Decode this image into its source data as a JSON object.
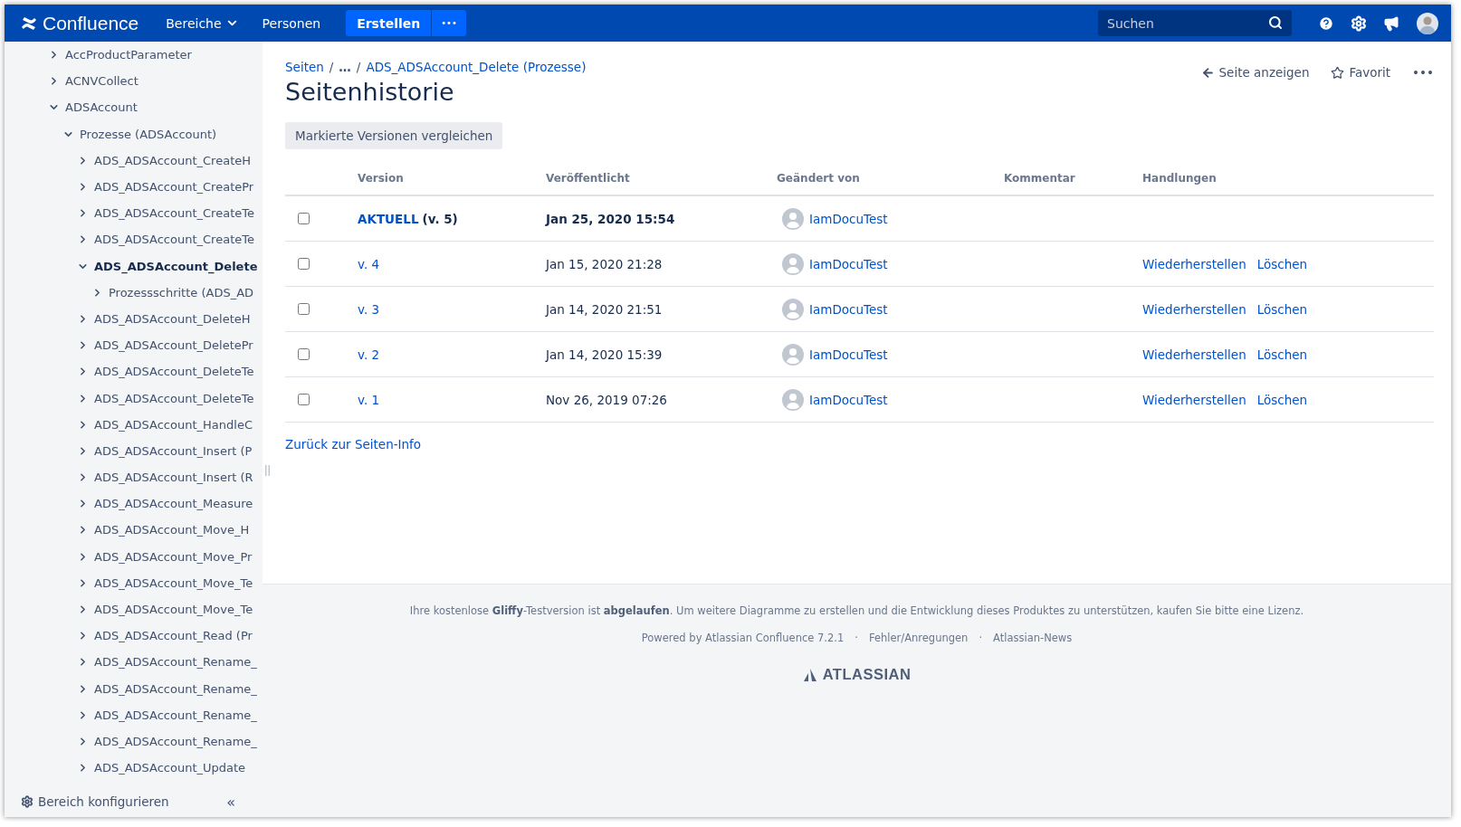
{
  "header": {
    "logo": "Confluence",
    "nav": [
      {
        "label": "Bereiche",
        "dropdown": true
      },
      {
        "label": "Personen",
        "dropdown": false
      }
    ],
    "create_button": "Erstellen",
    "more_button": "•••",
    "search": {
      "placeholder": "Suchen"
    }
  },
  "sidebar": {
    "tree": [
      {
        "label": "AccProductParameter",
        "expanded": false,
        "selected": false
      },
      {
        "label": "ACNVCollect",
        "expanded": false,
        "selected": false
      },
      {
        "label": "ADSAccount",
        "expanded": true,
        "selected": false,
        "children": [
          {
            "label": "Prozesse (ADSAccount)",
            "expanded": true,
            "selected": false,
            "children": [
              {
                "label": "ADS_ADSAccount_CreateH",
                "expanded": false,
                "selected": false
              },
              {
                "label": "ADS_ADSAccount_CreatePr",
                "expanded": false,
                "selected": false
              },
              {
                "label": "ADS_ADSAccount_CreateTe",
                "expanded": false,
                "selected": false
              },
              {
                "label": "ADS_ADSAccount_CreateTe",
                "expanded": false,
                "selected": false
              },
              {
                "label": "ADS_ADSAccount_Delete",
                "expanded": true,
                "selected": true,
                "children": [
                  {
                    "label": "Prozessschritte (ADS_AD",
                    "expanded": false,
                    "selected": false
                  }
                ]
              },
              {
                "label": "ADS_ADSAccount_DeleteH",
                "expanded": false,
                "selected": false
              },
              {
                "label": "ADS_ADSAccount_DeletePr",
                "expanded": false,
                "selected": false
              },
              {
                "label": "ADS_ADSAccount_DeleteTe",
                "expanded": false,
                "selected": false
              },
              {
                "label": "ADS_ADSAccount_DeleteTe",
                "expanded": false,
                "selected": false
              },
              {
                "label": "ADS_ADSAccount_HandleC",
                "expanded": false,
                "selected": false
              },
              {
                "label": "ADS_ADSAccount_Insert (P",
                "expanded": false,
                "selected": false
              },
              {
                "label": "ADS_ADSAccount_Insert (R",
                "expanded": false,
                "selected": false
              },
              {
                "label": "ADS_ADSAccount_Measure",
                "expanded": false,
                "selected": false
              },
              {
                "label": "ADS_ADSAccount_Move_H",
                "expanded": false,
                "selected": false
              },
              {
                "label": "ADS_ADSAccount_Move_Pr",
                "expanded": false,
                "selected": false
              },
              {
                "label": "ADS_ADSAccount_Move_Te",
                "expanded": false,
                "selected": false
              },
              {
                "label": "ADS_ADSAccount_Move_Te",
                "expanded": false,
                "selected": false
              },
              {
                "label": "ADS_ADSAccount_Read (Pr",
                "expanded": false,
                "selected": false
              },
              {
                "label": "ADS_ADSAccount_Rename_",
                "expanded": false,
                "selected": false
              },
              {
                "label": "ADS_ADSAccount_Rename_",
                "expanded": false,
                "selected": false
              },
              {
                "label": "ADS_ADSAccount_Rename_",
                "expanded": false,
                "selected": false
              },
              {
                "label": "ADS_ADSAccount_Rename_",
                "expanded": false,
                "selected": false
              },
              {
                "label": "ADS_ADSAccount_Update",
                "expanded": false,
                "selected": false
              }
            ]
          }
        ]
      }
    ],
    "configure": "Bereich konfigurieren",
    "collapse": "«"
  },
  "breadcrumb": [
    {
      "label": "Seiten",
      "kind": "link"
    },
    {
      "label": "/",
      "kind": "separator"
    },
    {
      "label": "…",
      "kind": "ellipsis"
    },
    {
      "label": "/",
      "kind": "separator"
    },
    {
      "label": "ADS_ADSAccount_Delete (Prozesse)",
      "kind": "link"
    }
  ],
  "page_actions": {
    "view": "Seite anzeigen",
    "favorite": "Favorit",
    "more": "•••"
  },
  "title": "Seitenhistorie",
  "compare_button": "Markierte Versionen vergleichen",
  "table": {
    "columns": [
      "Version",
      "Veröffentlicht",
      "Geändert von",
      "Kommentar",
      "Handlungen"
    ],
    "rows": [
      {
        "kind": "current",
        "version": "AKTUELL",
        "version_note": "(v. 5)",
        "published": "Jan 25, 2020 15:54",
        "author": "IamDocuTest",
        "checked": false
      },
      {
        "kind": "old",
        "version": "v. 4",
        "published": "Jan 15, 2020 21:28",
        "author": "IamDocuTest",
        "checked": false,
        "actions": [
          "Wiederherstellen",
          "Löschen"
        ]
      },
      {
        "kind": "old",
        "version": "v. 3",
        "published": "Jan 14, 2020 21:51",
        "author": "IamDocuTest",
        "checked": false,
        "actions": [
          "Wiederherstellen",
          "Löschen"
        ]
      },
      {
        "kind": "old",
        "version": "v. 2",
        "published": "Jan 14, 2020 15:39",
        "author": "IamDocuTest",
        "checked": false,
        "actions": [
          "Wiederherstellen",
          "Löschen"
        ]
      },
      {
        "kind": "old",
        "version": "v. 1",
        "published": "Nov 26, 2019 07:26",
        "author": "IamDocuTest",
        "checked": false,
        "actions": [
          "Wiederherstellen",
          "Löschen"
        ]
      }
    ]
  },
  "back_link": "Zurück zur Seiten-Info",
  "footer": {
    "notice": "Ihre kostenlose **Gliffy**-Testversion ist **abgelaufen**. Um weitere Diagramme zu erstellen und die Entwicklung dieses Produktes zu unterstützen, kaufen Sie bitte eine Lizenz.",
    "links": [
      {
        "label": "Powered by Atlassian Confluence 7.2.1",
        "kind": "text"
      },
      {
        "label": "·",
        "kind": "separator"
      },
      {
        "label": "Fehler/Anregungen",
        "kind": "link"
      },
      {
        "label": "·",
        "kind": "separator"
      },
      {
        "label": "Atlassian-News",
        "kind": "link"
      }
    ],
    "brand": "ATLASSIAN"
  }
}
